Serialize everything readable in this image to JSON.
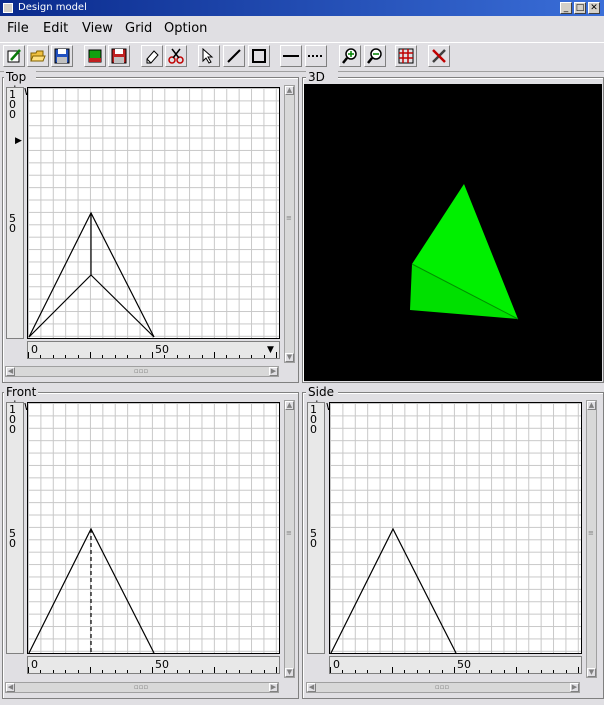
{
  "window": {
    "title": "Design model"
  },
  "menubar": {
    "items": [
      "File",
      "Edit",
      "View",
      "Grid",
      "Option"
    ]
  },
  "toolbar": {
    "buttons": [
      {
        "name": "new-button",
        "icon": "pencil-icon"
      },
      {
        "name": "open-button",
        "icon": "folder-open-icon"
      },
      {
        "name": "save-button",
        "icon": "floppy-icon"
      },
      {
        "name": "export-button",
        "icon": "green-model-icon"
      },
      {
        "name": "save-as-button",
        "icon": "floppy-red-icon"
      },
      {
        "name": "eraser-button",
        "icon": "eraser-icon"
      },
      {
        "name": "cut-button",
        "icon": "scissors-icon"
      },
      {
        "name": "select-button",
        "icon": "arrow-cursor-icon"
      },
      {
        "name": "line-tool-button",
        "icon": "line-icon"
      },
      {
        "name": "rectangle-tool-button",
        "icon": "rectangle-icon"
      },
      {
        "name": "solid-line-button",
        "icon": "solid-line-icon"
      },
      {
        "name": "dashed-line-button",
        "icon": "dashed-line-icon"
      },
      {
        "name": "zoom-in-button",
        "icon": "zoom-in-icon"
      },
      {
        "name": "zoom-out-button",
        "icon": "zoom-out-icon"
      },
      {
        "name": "grid-button",
        "icon": "grid-icon"
      },
      {
        "name": "tools-button",
        "icon": "tools-icon"
      }
    ]
  },
  "views": {
    "top": {
      "label": "Top view",
      "v_ruler": [
        "1",
        "0",
        "0",
        "5",
        "0"
      ],
      "h_ruler": [
        "0",
        "50"
      ]
    },
    "three_d": {
      "label": "3D view",
      "model_color": "#00ff00",
      "background": "#000000"
    },
    "front": {
      "label": "Front view",
      "v_ruler": [
        "1",
        "0",
        "0",
        "5",
        "0"
      ],
      "h_ruler": [
        "0",
        "50"
      ]
    },
    "side": {
      "label": "Side view",
      "v_ruler": [
        "1",
        "0",
        "0",
        "5",
        "0"
      ],
      "h_ruler": [
        "0",
        "50"
      ]
    }
  }
}
